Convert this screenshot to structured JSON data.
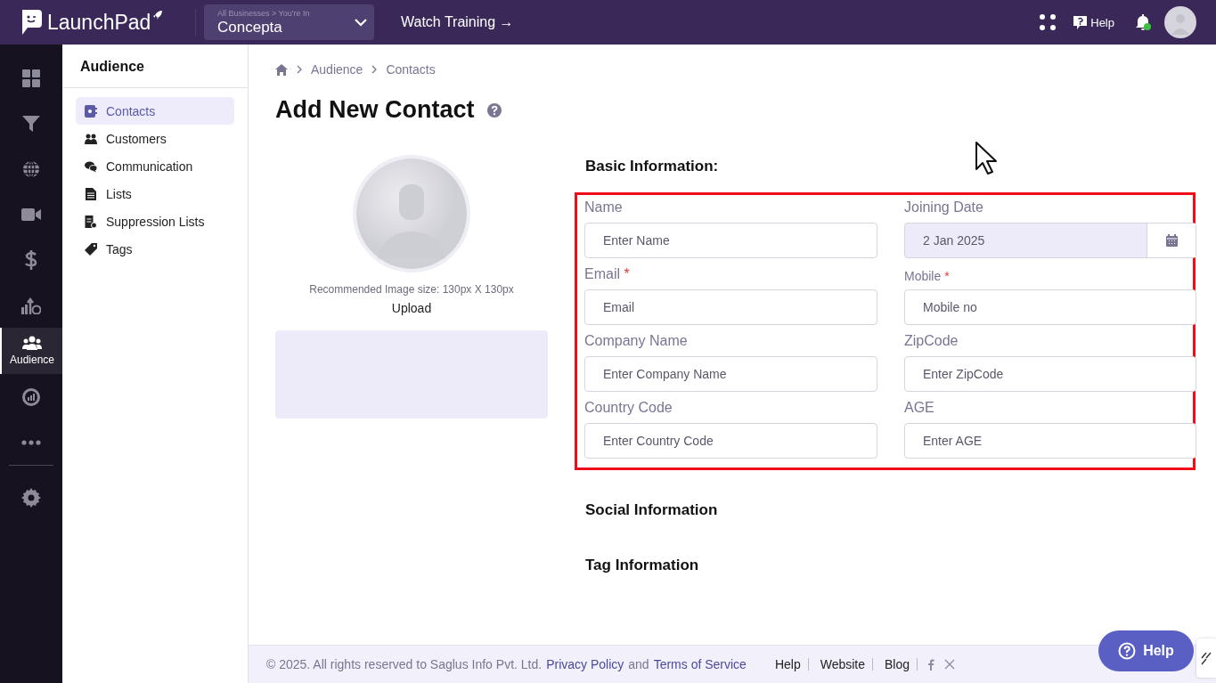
{
  "top_bar": {
    "brand": "LaunchPad",
    "business_switcher": {
      "caption": "All Businesses > You're In",
      "value": "Concepta"
    },
    "training_link": "Watch Training →",
    "help": "Help",
    "notification_dot": true
  },
  "rail": [
    {
      "selected": false
    },
    {
      "selected": false
    },
    {
      "selected": false
    },
    {
      "selected": false
    },
    {
      "selected": false
    },
    {
      "selected": false
    },
    {
      "label": "Audience",
      "selected": true
    },
    {
      "selected": false
    },
    {
      "selected": false
    },
    {
      "selected": false
    }
  ],
  "sidebar": {
    "title": "Audience",
    "items": [
      {
        "label": "Contacts",
        "selected": true
      },
      {
        "label": "Customers",
        "selected": false
      },
      {
        "label": "Communication",
        "selected": false
      },
      {
        "label": "Lists",
        "selected": false
      },
      {
        "label": "Suppression Lists",
        "selected": false
      },
      {
        "label": "Tags",
        "selected": false
      }
    ]
  },
  "breadcrumb": [
    "Audience",
    "Contacts"
  ],
  "page_title": "Add New Contact",
  "photo": {
    "hint": "Recommended Image size: 130px X 130px",
    "upload": "Upload"
  },
  "basic_information": {
    "title": "Basic Information:",
    "fields": [
      {
        "label": "Name",
        "placeholder": "Enter Name",
        "kind": "text"
      },
      {
        "label": "Joining Date",
        "value": "2 Jan 2025",
        "kind": "date"
      },
      {
        "label": "Email",
        "required_mark": "*",
        "placeholder": "Email",
        "kind": "text"
      },
      {
        "label": "Mobile",
        "required_mark": "*",
        "placeholder": "Mobile no",
        "kind": "text",
        "small_label": true
      },
      {
        "label": "Company Name",
        "placeholder": "Enter Company Name",
        "kind": "text"
      },
      {
        "label": "ZipCode",
        "placeholder": "Enter ZipCode",
        "kind": "text"
      },
      {
        "label": "Country Code",
        "placeholder": "Enter Country Code",
        "kind": "text"
      },
      {
        "label": "AGE",
        "placeholder": "Enter AGE",
        "kind": "text"
      }
    ]
  },
  "sections": [
    "Social Information",
    "Tag Information"
  ],
  "footer": {
    "copyright": "©  2025. All rights reserved to Saglus Info Pvt. Ltd.",
    "privacy": "Privacy Policy",
    "and": "and",
    "terms": "Terms of Service",
    "links": [
      "Help",
      "Website",
      "Blog"
    ]
  },
  "help_button": "Help"
}
